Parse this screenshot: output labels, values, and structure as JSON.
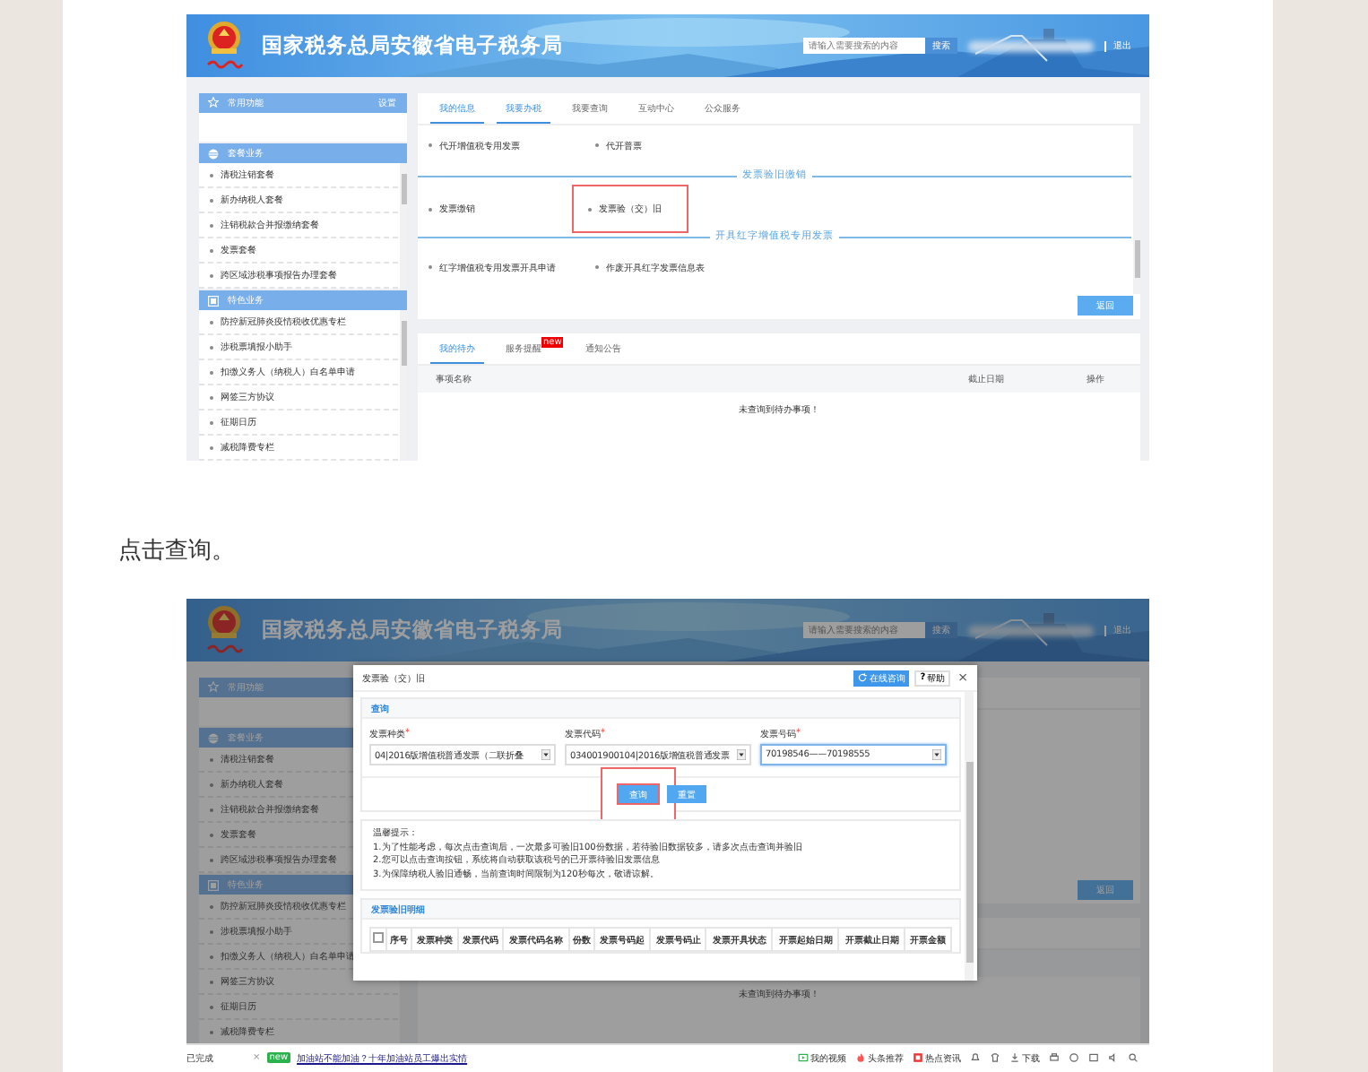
{
  "article": {
    "screenshot_1": {
      "header": {
        "title": "国家税务总局安徽省电子税务局",
        "search": {
          "placeholder": "请输入需要搜索的内容"
        },
        "search_button": "搜索",
        "logout": "退出"
      },
      "sidebar": [
        {
          "title": "常用功能",
          "action": "设置"
        },
        {
          "title": "套餐业务",
          "items": [
            "清税注销套餐",
            "新办纳税人套餐",
            "注销税款合并报缴纳套餐",
            "发票套餐",
            "跨区域涉税事项报告办理套餐"
          ]
        },
        {
          "title": "特色业务",
          "items": [
            "防控新冠肺炎疫情税收优惠专栏",
            "涉税票填报小助手",
            "扣缴义务人（纳税人）白名单申请",
            "网签三方协议",
            "征期日历",
            "减税降费专栏"
          ]
        }
      ],
      "tabs": [
        {
          "label": "我的信息",
          "selected": true
        },
        {
          "label": "我要办税",
          "selected": true
        },
        {
          "label": "我要查询",
          "selected": false
        },
        {
          "label": "互动中心",
          "selected": false
        },
        {
          "label": "公众服务",
          "selected": false
        }
      ],
      "groups": [
        {
          "items": [
            {
              "label": "代开增值税专用发票",
              "highlighted": false
            },
            {
              "label": "代开普票",
              "highlighted": false
            }
          ]
        },
        {
          "title": "发票验旧缴销",
          "items": [
            {
              "label": "发票缴销",
              "highlighted": false
            },
            {
              "label": "发票验（交）旧",
              "highlighted": true
            }
          ]
        },
        {
          "title": "开具红字增值税专用发票",
          "items": [
            {
              "label": "红字增值税专用发票开具申请",
              "highlighted": false
            },
            {
              "label": "作废开具红字发票信息表",
              "highlighted": false
            }
          ]
        }
      ],
      "back_button": "返回",
      "todo": {
        "tabs": [
          {
            "label": "我的待办",
            "selected": true
          },
          {
            "label": "服务提醒",
            "selected": false,
            "badge": "new"
          },
          {
            "label": "通知公告",
            "selected": false
          }
        ],
        "columns": [
          "事项名称",
          "截止日期",
          "操作"
        ],
        "empty_message": "未查询到待办事项！"
      }
    },
    "caption": "点击查询。",
    "screenshot_2": {
      "header": {
        "title": "国家税务总局安徽省电子税务局",
        "search": {
          "placeholder": "请输入需要搜索的内容"
        },
        "search_button": "搜索",
        "logout": "退出"
      },
      "sidebar": [
        {
          "title": "常用功能"
        },
        {
          "title": "套餐业务",
          "items": [
            "清税注销套餐",
            "新办纳税人套餐",
            "注销税款合并报缴纳套餐",
            "发票套餐",
            "跨区域涉税事项报告办理套餐"
          ]
        },
        {
          "title": "特色业务",
          "items": [
            "防控新冠肺炎疫情税收优惠专栏",
            "涉税票填报小助手",
            "扣缴义务人（纳税人）白名单申请",
            "网签三方协议",
            "征期日历",
            "减税降费专栏"
          ]
        }
      ],
      "back_button": "返回",
      "todo": {
        "empty_message": "未查询到待办事项！"
      },
      "dialog": {
        "title": "发票验（交）旧",
        "consult_button": "在线咨询",
        "help_icon": "?",
        "help_button": "帮助",
        "close": "×",
        "query": {
          "title": "查询",
          "fields": [
            {
              "label": "发票种类",
              "required_mark": "*",
              "value": "04|2016版增值税普通发票（二联折叠",
              "focused": false
            },
            {
              "label": "发票代码",
              "required_mark": "*",
              "value": "034001900104|2016版增值税普通发票",
              "focused": false
            },
            {
              "label": "发票号码",
              "required_mark": "*",
              "value": "70198546——70198555",
              "focused": true
            }
          ],
          "buttons": [
            {
              "label": "查询",
              "highlighted": true
            },
            {
              "label": "重置",
              "highlighted": false
            }
          ]
        },
        "tips": {
          "title": "温馨提示：",
          "lines": [
            "1.为了性能考虑，每次点击查询后，一次最多可验旧100份数据，若待验旧数据较多，请多次点击查询并验旧",
            "2.您可以点击查询按钮，系统将自动获取该税号的已开票待验旧发票信息",
            "3.为保障纳税人验旧通畅，当前查询时间限制为120秒每次，敬请谅解。"
          ]
        },
        "details": {
          "title": "发票验旧明细",
          "select_all": {
            "checked": false
          },
          "columns": [
            "序号",
            "发票种类",
            "发票代码",
            "发票代码名称",
            "份数",
            "发票号码起",
            "发票号码止",
            "发票开具状态",
            "开票起始日期",
            "开票截止日期",
            "开票金额"
          ]
        }
      },
      "status_bar": {
        "left_text": "已完成",
        "close": "×",
        "badge": "new",
        "link": "加油站不能加油？十年加油站员工爆出实情",
        "right_items": [
          "我的视频",
          "头条推荐",
          "热点资讯"
        ],
        "download": "下载"
      }
    }
  }
}
